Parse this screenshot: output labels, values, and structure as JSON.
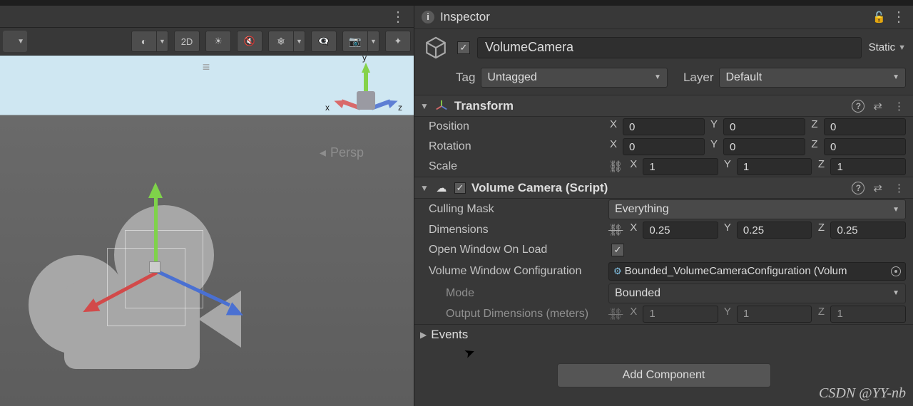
{
  "inspector": {
    "title": "Inspector",
    "object_name": "VolumeCamera",
    "object_enabled": true,
    "static_label": "Static",
    "tag_label": "Tag",
    "tag_value": "Untagged",
    "layer_label": "Layer",
    "layer_value": "Default"
  },
  "transform": {
    "title": "Transform",
    "position_label": "Position",
    "position": {
      "x": "0",
      "y": "0",
      "z": "0"
    },
    "rotation_label": "Rotation",
    "rotation": {
      "x": "0",
      "y": "0",
      "z": "0"
    },
    "scale_label": "Scale",
    "scale": {
      "x": "1",
      "y": "1",
      "z": "1"
    }
  },
  "volume_camera": {
    "title": "Volume Camera (Script)",
    "enabled": true,
    "culling_mask_label": "Culling Mask",
    "culling_mask_value": "Everything",
    "dimensions_label": "Dimensions",
    "dimensions": {
      "x": "0.25",
      "y": "0.25",
      "z": "0.25"
    },
    "open_window_label": "Open Window On Load",
    "open_window_value": true,
    "config_label": "Volume Window Configuration",
    "config_value": "Bounded_VolumeCameraConfiguration (Volum",
    "mode_label": "Mode",
    "mode_value": "Bounded",
    "output_dim_label": "Output Dimensions (meters)",
    "output_dim": {
      "x": "1",
      "y": "1",
      "z": "1"
    }
  },
  "events_label": "Events",
  "add_component_label": "Add Component",
  "scene": {
    "toolbar_2d": "2D",
    "persp_label": "Persp",
    "axes": {
      "x": "x",
      "y": "y",
      "z": "z"
    }
  },
  "axes": {
    "x": "X",
    "y": "Y",
    "z": "Z"
  },
  "watermark": "CSDN @YY-nb"
}
